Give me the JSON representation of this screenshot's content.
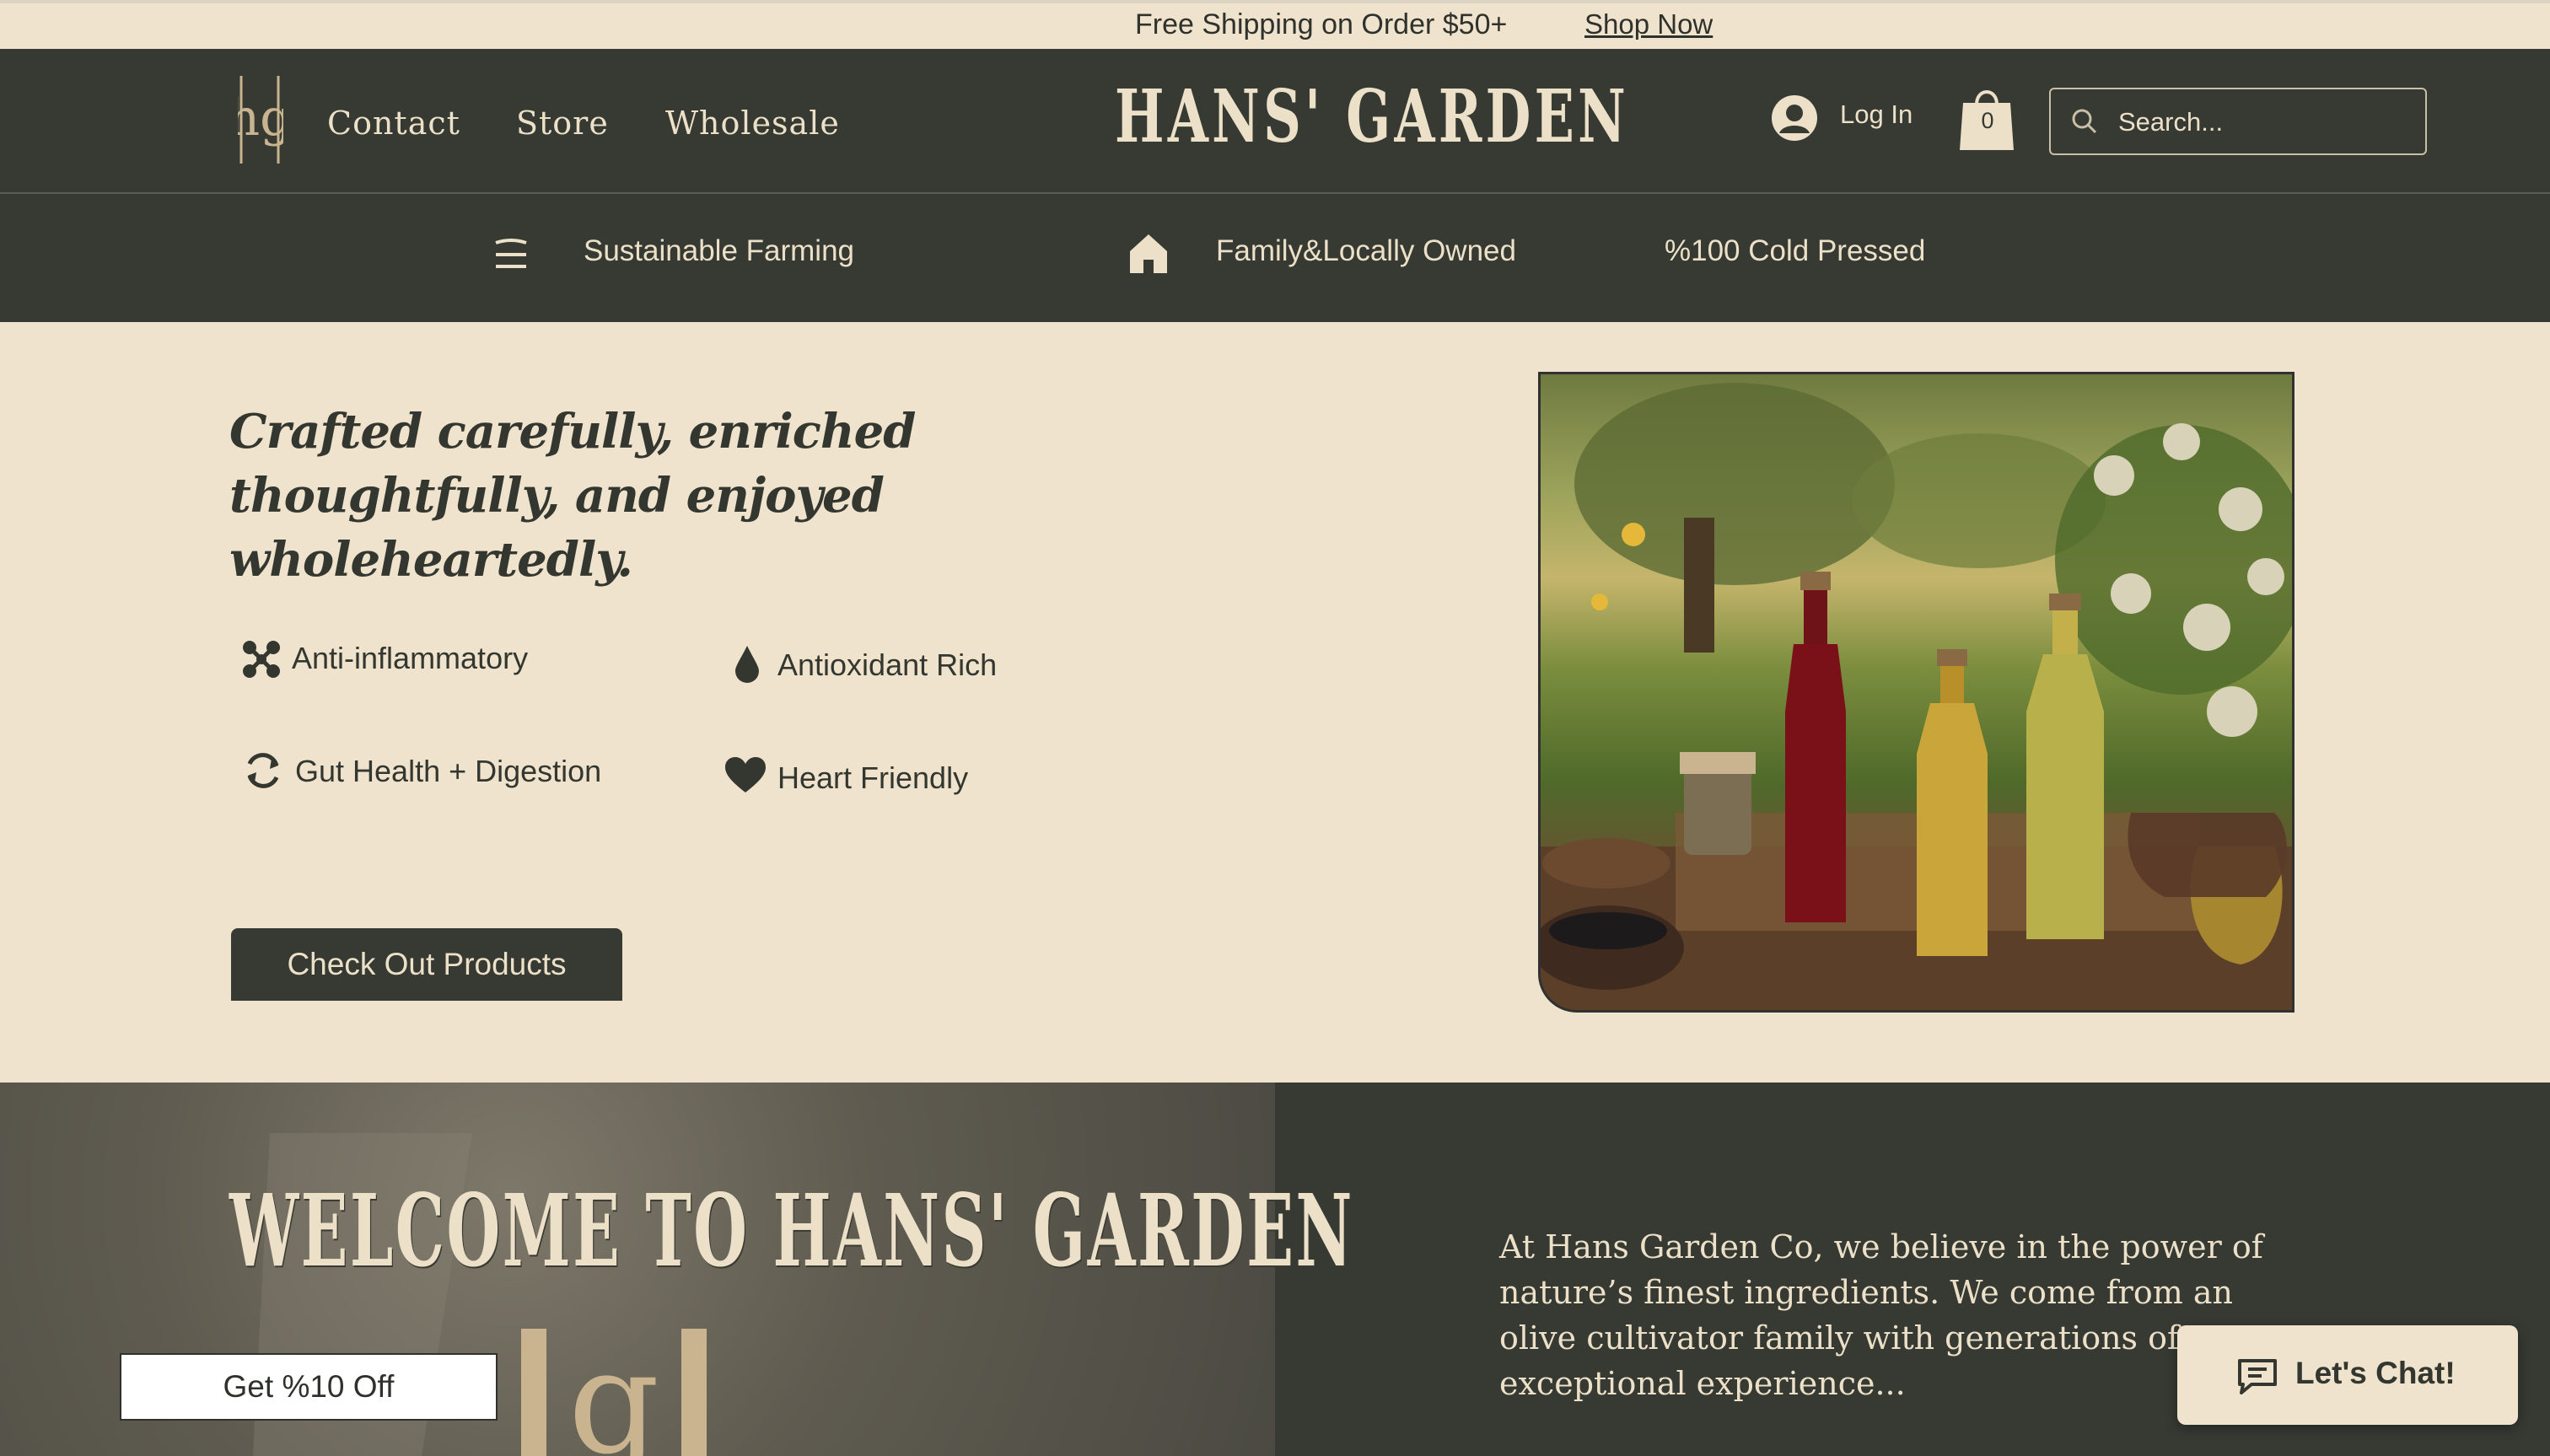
{
  "announcement": {
    "message": "Free Shipping on Order $50+",
    "link": "Shop Now"
  },
  "header": {
    "logo_mark": "hg",
    "nav": [
      "Contact",
      "Store",
      "Wholesale"
    ],
    "brand": "HANS' GARDEN",
    "login_label": "Log In",
    "cart_count": "0",
    "search_placeholder": "Search..."
  },
  "value_props": [
    "Sustainable Farming",
    "Family&Locally Owned",
    "%100 Cold Pressed"
  ],
  "hero": {
    "headline": "Crafted carefully, enriched thoughtfully, and enjoyed wholeheartedly.",
    "benefits": [
      {
        "label": "Anti-inflammatory",
        "icon": "molecule-icon"
      },
      {
        "label": "Antioxidant Rich",
        "icon": "drop-icon"
      },
      {
        "label": "Gut Health + Digestion",
        "icon": "refresh-icon"
      },
      {
        "label": "Heart Friendly",
        "icon": "heart-icon"
      }
    ],
    "cta_label": "Check Out Products"
  },
  "welcome": {
    "title": "WELCOME TO HANS' GARDEN",
    "about": "At Hans Garden Co, we believe in the power of nature’s finest ingredients. We come from an olive cultivator family with generations of exceptional experience..."
  },
  "discount_label": "Get %10 Off",
  "chat_label": "Let's Chat!",
  "colors": {
    "dark": "#363a33",
    "cream": "#efe3cd",
    "text_light": "#ece0c8"
  }
}
